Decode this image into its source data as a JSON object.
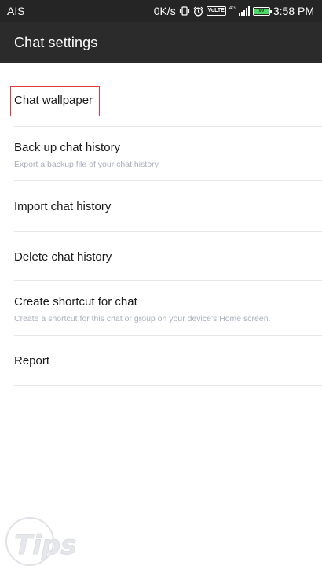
{
  "status_bar": {
    "carrier": "AIS",
    "network_speed": "0K/s",
    "volte_label": "VoLTE",
    "network_type": "4G",
    "battery_label": "99",
    "battery_level": 0.99,
    "time": "3:58 PM",
    "icons": [
      "vibrate-icon",
      "alarm-icon",
      "volte-icon",
      "signal-icon",
      "battery-icon"
    ]
  },
  "app_bar": {
    "title": "Chat settings"
  },
  "settings": {
    "items": [
      {
        "title": "Chat wallpaper",
        "subtitle": ""
      },
      {
        "title": "Back up chat history",
        "subtitle": "Export a backup file of your chat history."
      },
      {
        "title": "Import chat history",
        "subtitle": ""
      },
      {
        "title": "Delete chat history",
        "subtitle": ""
      },
      {
        "title": "Create shortcut for chat",
        "subtitle": "Create a shortcut for this chat or group on your device's Home screen."
      },
      {
        "title": "Report",
        "subtitle": ""
      }
    ],
    "highlight_color": "#e03a3a"
  },
  "watermark": {
    "text": "Tips",
    "icon": "tips-logo-watermark"
  },
  "colors": {
    "status_bar_bg": "#252525",
    "app_bar_bg": "#2b2b2b",
    "background": "#ffffff",
    "subtitle_text": "#a9afbd",
    "divider": "#e6e6e6"
  }
}
